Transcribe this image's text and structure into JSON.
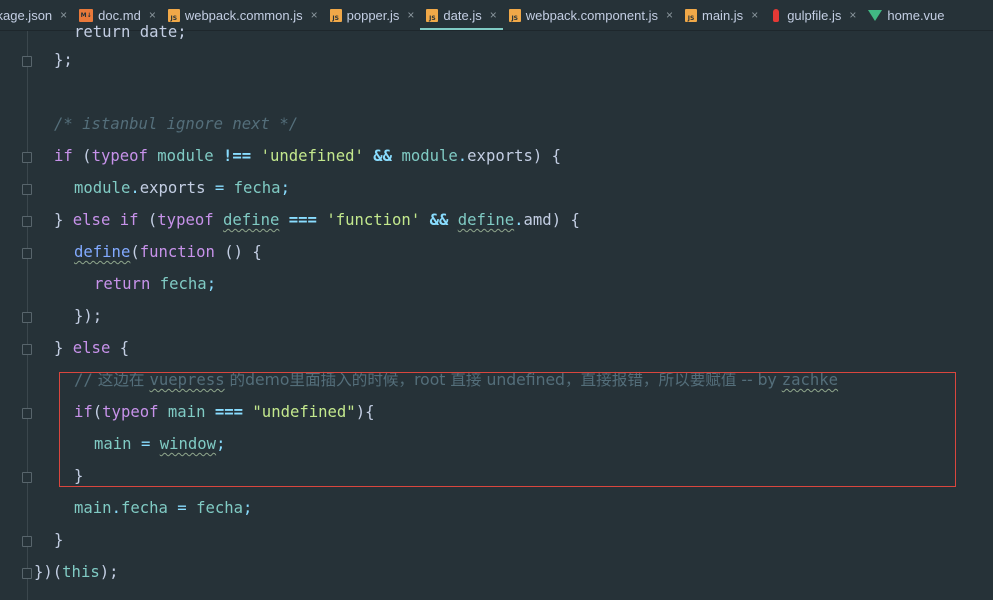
{
  "tabs": [
    {
      "label": "ckage.json",
      "icon": "json-file-icon"
    },
    {
      "label": "doc.md",
      "icon": "markdown-file-icon"
    },
    {
      "label": "webpack.common.js",
      "icon": "js-file-icon"
    },
    {
      "label": "popper.js",
      "icon": "js-file-icon"
    },
    {
      "label": "date.js",
      "icon": "js-file-icon",
      "active": true
    },
    {
      "label": "webpack.component.js",
      "icon": "js-file-icon"
    },
    {
      "label": "main.js",
      "icon": "js-file-icon"
    },
    {
      "label": "gulpfile.js",
      "icon": "gulp-file-icon"
    },
    {
      "label": "home.vue",
      "icon": "vue-file-icon"
    }
  ],
  "tab_icon_labels": {
    "js": "JS",
    "md": "M↓"
  },
  "tab_close_glyph": "×",
  "accent_color": "#80cbc4",
  "highlight_color": "#d9463e",
  "code": {
    "cut_top": "return date;",
    "l1": {
      "text": "};"
    },
    "l2": {
      "comment": "/* istanbul ignore next */"
    },
    "l3": {
      "if": "if",
      "p1": " (",
      "typeof": "typeof",
      "module": "module",
      "neq": "!==",
      "str": "'undefined'",
      "and": "&&",
      "module2": "module",
      "dot": ".",
      "exports": "exports",
      "tail": ") {"
    },
    "l4": {
      "module": "module",
      "dot": ".",
      "exports": "exports",
      "eq": "=",
      "fecha": "fecha",
      "semi": ";"
    },
    "l5": {
      "lead": "} ",
      "else": "else",
      "if": "if",
      "p1": " (",
      "typeof": "typeof",
      "define": "define",
      "eq3": "===",
      "str": "'function'",
      "and": "&&",
      "define2": "define",
      "dot": ".",
      "amd": "amd",
      "tail": ") {"
    },
    "l6": {
      "define": "define",
      "p1": "(",
      "function": "function",
      "tail": " () {"
    },
    "l7": {
      "return": "return",
      "fecha": "fecha",
      "semi": ";"
    },
    "l8": {
      "text": "});"
    },
    "l9": {
      "lead": "} ",
      "else": "else",
      "tail": " {"
    },
    "l10": {
      "slash": "//",
      "p1": " 这边在 ",
      "vuepress": "vuepress",
      "p2": " 的demo里面插入的时候，root 直接 undefined，直接报错，所以要赋值 -- by ",
      "zachke": "zachke"
    },
    "l11": {
      "if": "if",
      "p1": "(",
      "typeof": "typeof",
      "main": "main",
      "eq3": "===",
      "str": "\"undefined\"",
      "tail": "){"
    },
    "l12": {
      "main": "main",
      "eq": "=",
      "window": "window",
      "semi": ";"
    },
    "l13": {
      "text": "}"
    },
    "l14": {
      "main": "main",
      "dot": ".",
      "fecha": "fecha",
      "eq": "=",
      "fecha2": "fecha",
      "semi": ";"
    },
    "l15": {
      "text": "}"
    },
    "l16": {
      "lead": "})(",
      "this": "this",
      "tail": ");"
    }
  }
}
